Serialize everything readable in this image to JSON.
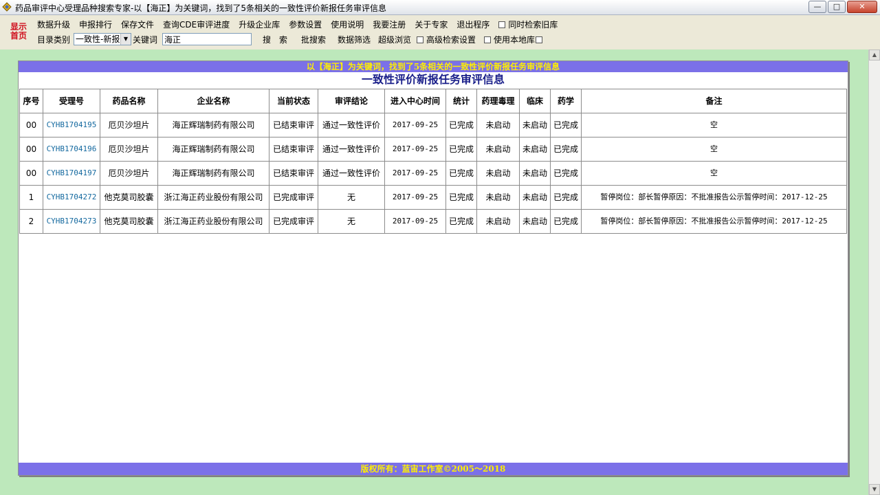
{
  "window": {
    "title": "药品审评中心受理品种搜索专家-以【海正】为关键词，找到了5条相关的一致性评价新报任务审评信息",
    "minimize": "—",
    "maximize": "□",
    "close": "✕"
  },
  "logo": {
    "line1": "显示",
    "line2": "首页"
  },
  "menu": {
    "items": [
      "数据升级",
      "申报排行",
      "保存文件",
      "查询CDE审评进度",
      "升级企业库",
      "参数设置",
      "使用说明",
      "我要注册",
      "关于专家",
      "退出程序"
    ],
    "check_old": "同时检索旧库"
  },
  "search": {
    "catalog_label": "目录类别",
    "catalog_value": "一致性-新报",
    "keyword_label": "关键词",
    "keyword_value": "海正",
    "search_btn": "搜　索",
    "batch_btn": "批搜索",
    "filter_btn": "数据筛选",
    "super_btn": "超级浏览",
    "adv_label": "高级检索设置",
    "local_label": "使用本地库"
  },
  "result": {
    "banner": "以【海正】为关键词，找到了5条相关的一致性评价新报任务审评信息",
    "heading": "一致性评价新报任务审评信息",
    "footer": "版权所有：蓝宙工作室©2005～2018"
  },
  "table": {
    "headers": [
      "序号",
      "受理号",
      "药品名称",
      "企业名称",
      "当前状态",
      "审评结论",
      "进入中心时间",
      "统计",
      "药理毒理",
      "临床",
      "药学",
      "备注"
    ],
    "rows": [
      [
        "00",
        "CYHB1704195",
        "厄贝沙坦片",
        "海正辉瑞制药有限公司",
        "已结束审评",
        "通过一致性评价",
        "2017-09-25",
        "已完成",
        "未启动",
        "未启动",
        "已完成",
        "空"
      ],
      [
        "00",
        "CYHB1704196",
        "厄贝沙坦片",
        "海正辉瑞制药有限公司",
        "已结束审评",
        "通过一致性评价",
        "2017-09-25",
        "已完成",
        "未启动",
        "未启动",
        "已完成",
        "空"
      ],
      [
        "00",
        "CYHB1704197",
        "厄贝沙坦片",
        "海正辉瑞制药有限公司",
        "已结束审评",
        "通过一致性评价",
        "2017-09-25",
        "已完成",
        "未启动",
        "未启动",
        "已完成",
        "空"
      ],
      [
        "1",
        "CYHB1704272",
        "他克莫司胶囊",
        "浙江海正药业股份有限公司",
        "已完成审评",
        "无",
        "2017-09-25",
        "已完成",
        "未启动",
        "未启动",
        "已完成",
        "暂停岗位：部长暂停原因：不批准报告公示暂停时间：2017-12-25"
      ],
      [
        "2",
        "CYHB1704273",
        "他克莫司胶囊",
        "浙江海正药业股份有限公司",
        "已完成审评",
        "无",
        "2017-09-25",
        "已完成",
        "未启动",
        "未启动",
        "已完成",
        "暂停岗位：部长暂停原因：不批准报告公示暂停时间：2017-12-25"
      ]
    ]
  }
}
